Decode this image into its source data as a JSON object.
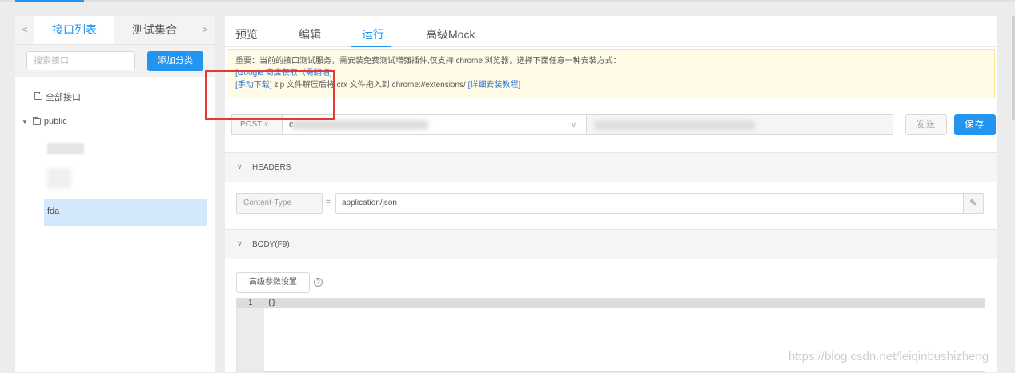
{
  "left_panel": {
    "tabs": [
      {
        "label": "<"
      },
      {
        "label": "接口列表"
      },
      {
        "label": "测试集合"
      },
      {
        "label": ">"
      }
    ],
    "search_placeholder": "搜索接口",
    "add_button": "添加分类",
    "tree": {
      "all_label": "全部接口",
      "group_label": "public",
      "selected_item": "fda"
    }
  },
  "main": {
    "tabs": [
      "预览",
      "编辑",
      "运行",
      "高级Mock"
    ],
    "active_tab": "运行",
    "notice": {
      "line1": "重要：当前的接口测试服务，需安装免费测试增强插件,仅支持 chrome 浏览器，选择下面任意一种安装方式：",
      "link_store": "[Google 商店获取（需翻墙]",
      "link_manual": "[手动下载]",
      "line3_text": " zip 文件解压后将 crx 文件拖入到 chrome://extensions/ ",
      "link_tutorial": "[详细安装教程]"
    },
    "request": {
      "method": "POST",
      "url_prefix": "c",
      "send_button": "发送",
      "save_button": "保存"
    },
    "headers_section": {
      "title": "HEADERS",
      "key": "Content-Type",
      "eq": "=",
      "value": "application/json"
    },
    "body_section": {
      "title": "BODY(F9)",
      "advanced_button": "高级参数设置",
      "help": "?",
      "line_number": "1",
      "code": "{}"
    }
  },
  "watermark": "https://blog.csdn.net/leiqinbushizheng",
  "colors": {
    "accent": "#2395f1",
    "notice_bg": "#fffbe6",
    "highlight_box": "#e53935"
  },
  "icons": {
    "folder": "folder-icon",
    "caret": "caret-down-icon",
    "chevron": "chevron-down-icon",
    "edit": "edit-icon",
    "help": "question-circle-icon"
  }
}
